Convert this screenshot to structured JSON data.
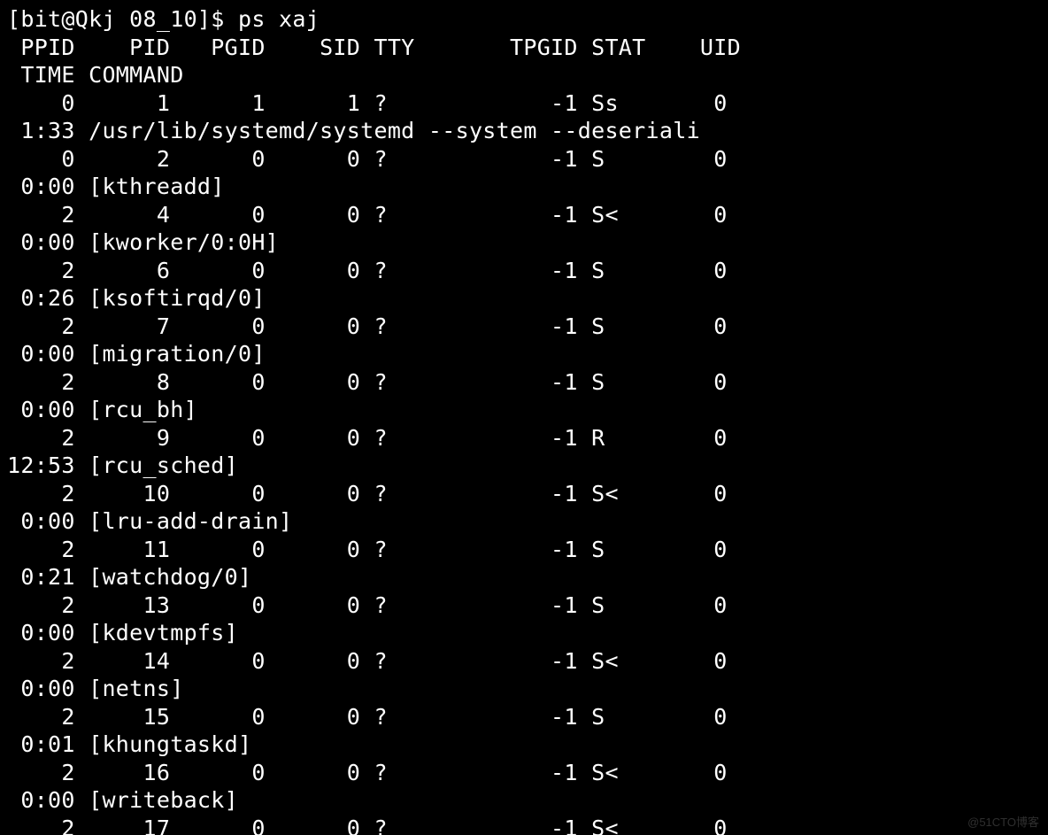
{
  "prompt": "[bit@Qkj 08_10]$ ps xaj",
  "header1": " PPID    PID   PGID    SID TTY       TPGID STAT    UID",
  "header2": " TIME COMMAND",
  "rows": [
    {
      "ppid": 0,
      "pid": 1,
      "pgid": 1,
      "sid": 1,
      "tty": "?",
      "tpgid": -1,
      "stat": "Ss",
      "uid": 0,
      "time": "1:33",
      "cmd": "/usr/lib/systemd/systemd --system --deseriali"
    },
    {
      "ppid": 0,
      "pid": 2,
      "pgid": 0,
      "sid": 0,
      "tty": "?",
      "tpgid": -1,
      "stat": "S",
      "uid": 0,
      "time": "0:00",
      "cmd": "[kthreadd]"
    },
    {
      "ppid": 2,
      "pid": 4,
      "pgid": 0,
      "sid": 0,
      "tty": "?",
      "tpgid": -1,
      "stat": "S<",
      "uid": 0,
      "time": "0:00",
      "cmd": "[kworker/0:0H]"
    },
    {
      "ppid": 2,
      "pid": 6,
      "pgid": 0,
      "sid": 0,
      "tty": "?",
      "tpgid": -1,
      "stat": "S",
      "uid": 0,
      "time": "0:26",
      "cmd": "[ksoftirqd/0]"
    },
    {
      "ppid": 2,
      "pid": 7,
      "pgid": 0,
      "sid": 0,
      "tty": "?",
      "tpgid": -1,
      "stat": "S",
      "uid": 0,
      "time": "0:00",
      "cmd": "[migration/0]"
    },
    {
      "ppid": 2,
      "pid": 8,
      "pgid": 0,
      "sid": 0,
      "tty": "?",
      "tpgid": -1,
      "stat": "S",
      "uid": 0,
      "time": "0:00",
      "cmd": "[rcu_bh]"
    },
    {
      "ppid": 2,
      "pid": 9,
      "pgid": 0,
      "sid": 0,
      "tty": "?",
      "tpgid": -1,
      "stat": "R",
      "uid": 0,
      "time": "12:53",
      "cmd": "[rcu_sched]"
    },
    {
      "ppid": 2,
      "pid": 10,
      "pgid": 0,
      "sid": 0,
      "tty": "?",
      "tpgid": -1,
      "stat": "S<",
      "uid": 0,
      "time": "0:00",
      "cmd": "[lru-add-drain]"
    },
    {
      "ppid": 2,
      "pid": 11,
      "pgid": 0,
      "sid": 0,
      "tty": "?",
      "tpgid": -1,
      "stat": "S",
      "uid": 0,
      "time": "0:21",
      "cmd": "[watchdog/0]"
    },
    {
      "ppid": 2,
      "pid": 13,
      "pgid": 0,
      "sid": 0,
      "tty": "?",
      "tpgid": -1,
      "stat": "S",
      "uid": 0,
      "time": "0:00",
      "cmd": "[kdevtmpfs]"
    },
    {
      "ppid": 2,
      "pid": 14,
      "pgid": 0,
      "sid": 0,
      "tty": "?",
      "tpgid": -1,
      "stat": "S<",
      "uid": 0,
      "time": "0:00",
      "cmd": "[netns]"
    },
    {
      "ppid": 2,
      "pid": 15,
      "pgid": 0,
      "sid": 0,
      "tty": "?",
      "tpgid": -1,
      "stat": "S",
      "uid": 0,
      "time": "0:01",
      "cmd": "[khungtaskd]"
    },
    {
      "ppid": 2,
      "pid": 16,
      "pgid": 0,
      "sid": 0,
      "tty": "?",
      "tpgid": -1,
      "stat": "S<",
      "uid": 0,
      "time": "0:00",
      "cmd": "[writeback]"
    },
    {
      "ppid": 2,
      "pid": 17,
      "pgid": 0,
      "sid": 0,
      "tty": "?",
      "tpgid": -1,
      "stat": "S<",
      "uid": 0,
      "time": "",
      "cmd": ""
    }
  ],
  "watermark": "@51CTO博客"
}
